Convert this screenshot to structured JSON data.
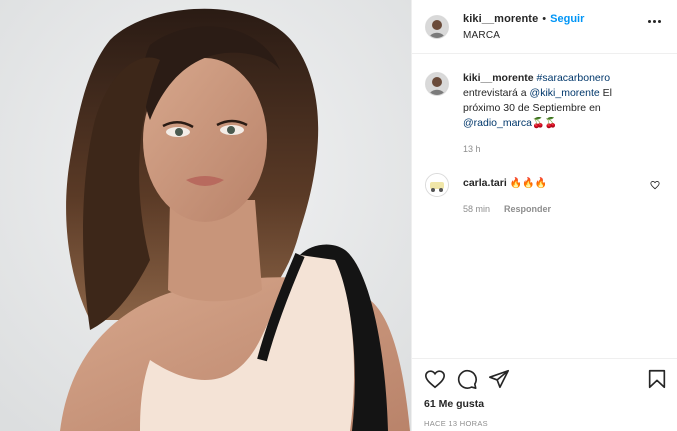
{
  "post": {
    "author": {
      "username": "kiki__morente",
      "separator": "•",
      "follow_label": "Seguir",
      "location": "MARCA"
    },
    "caption": {
      "username": "kiki__morente",
      "hashtag": "#saracarbonero",
      "text_1": "entrevistará a",
      "mention_1": "@kiki_morente",
      "text_2": "El próximo 30 de Septiembre en",
      "mention_2": "@radio_marca",
      "emojis": "🍒🍒",
      "time": "13 h"
    },
    "comments": [
      {
        "username": "carla.tari",
        "text": "🔥🔥🔥",
        "time": "58 min",
        "reply_label": "Responder"
      }
    ],
    "likes": "61 Me gusta",
    "posted_ago": "HACE 13 HORAS",
    "icons": [
      "heart-icon",
      "comment-icon",
      "share-icon",
      "bookmark-icon",
      "more-options-icon"
    ],
    "colors": {
      "accent": "#0095f6",
      "link": "#00376b",
      "muted": "#8e8e8e",
      "text": "#262626"
    }
  }
}
